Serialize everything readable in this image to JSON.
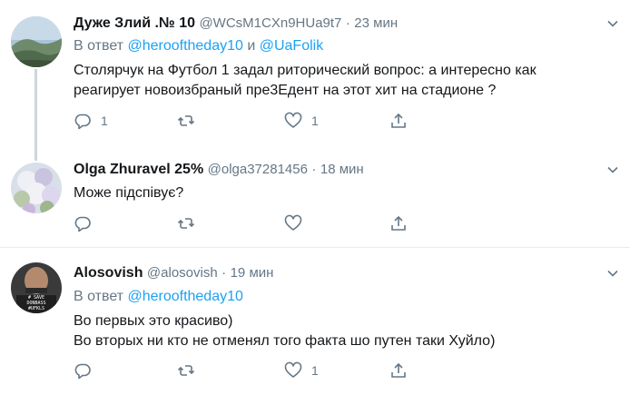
{
  "tweets": [
    {
      "name": "Дуже Злий .№ 10",
      "handle": "@WCsM1CXn9HUa9t7",
      "dot": "·",
      "time": "23 мин",
      "reply_prefix": "В ответ ",
      "reply_link_1": "@herooftheday10",
      "reply_joiner": " и ",
      "reply_link_2": "@UaFolik",
      "text_line_1": "Столярчук на Футбол 1 задал риторический вопрос: а интересно как",
      "text_line_2": "реагирует новоизбраный пре3Едент на этот хит на стадионе ?",
      "reply_count": "1",
      "retweet_count": "",
      "like_count": "1"
    },
    {
      "name": "Olga Zhuravel 25%",
      "handle": "@olga37281456",
      "dot": "·",
      "time": "18 мин",
      "text_line_1": "Може підспівує?",
      "reply_count": "",
      "retweet_count": "",
      "like_count": ""
    },
    {
      "name": "Alosovish",
      "handle": "@alosovish",
      "dot": "·",
      "time": "19 мин",
      "reply_prefix": "В ответ ",
      "reply_link_1": "@herooftheday10",
      "text_line_1": "Во первых это красиво)",
      "text_line_2": "Во вторых ни кто не отменял того факта шо путен таки Хуйло)",
      "reply_count": "",
      "retweet_count": "",
      "like_count": "1",
      "avatar_caption_1": "# SAVE",
      "avatar_caption_2": "DONBASS",
      "avatar_caption_3": "#UFKLS"
    }
  ],
  "icons": {
    "reply": "reply-icon",
    "retweet": "retweet-icon",
    "like": "heart-icon",
    "share": "share-icon",
    "more": "chevron-down-icon"
  },
  "colors": {
    "link": "#1da1f2",
    "secondary_text": "#657786",
    "thread_line": "#ccd6dd",
    "divider": "#e6ecf0"
  }
}
